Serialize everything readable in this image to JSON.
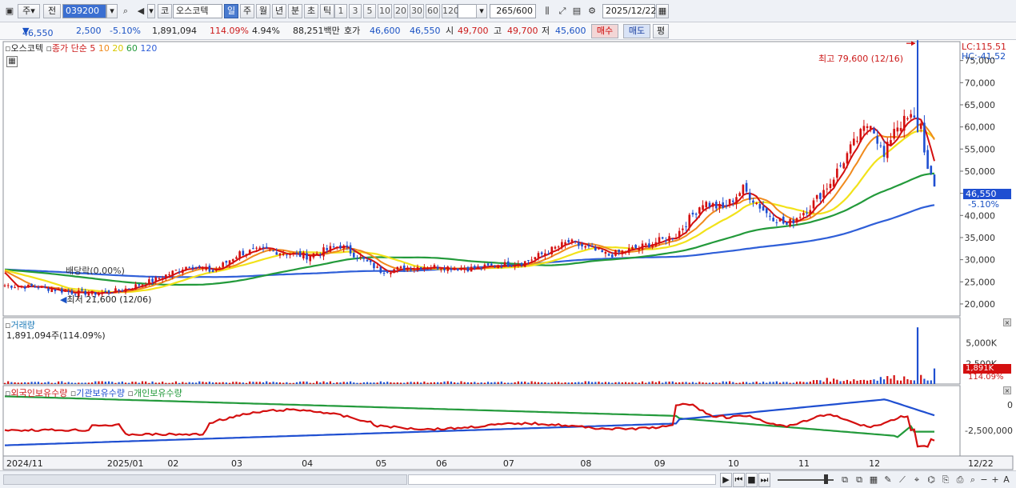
{
  "toolbar": {
    "period": "주",
    "prev": "전",
    "code": "039200",
    "market": "코",
    "name": "오스코텍",
    "intervals": [
      "일",
      "주",
      "월",
      "년",
      "분",
      "초",
      "틱"
    ],
    "selected_interval": "일",
    "minutes": [
      "1",
      "3",
      "5",
      "10",
      "20",
      "30",
      "60",
      "120"
    ],
    "count": "265",
    "count_total": "/600",
    "date": "2025/12/22"
  },
  "quote": {
    "price": "46,550",
    "change": "2,500",
    "change_pct": "-5.10%",
    "volume": "1,891,094",
    "vol_ratio": "114.09%",
    "turnover": "4.94%",
    "amount": "88,251백만",
    "ask_label": "호가",
    "ask": "46,600",
    "bid": "46,550",
    "open_label": "시",
    "open": "49,700",
    "high_label": "고",
    "high": "49,700",
    "low_label": "저",
    "low": "45,600",
    "buy": "매수",
    "sell": "매도",
    "eval": "평"
  },
  "legend": {
    "stock": "오스코텍",
    "ma_label": "종가 단순",
    "ma_periods": [
      "5",
      "10",
      "20",
      "60",
      "120"
    ],
    "lc": "LC:115.51",
    "hc": "HC:-41.52",
    "max_note": "최고 79,600 (12/16)",
    "min_note": "최저 21,600 (12/06)",
    "dividend": "배당락(0.00%)",
    "price_tag": "46,550",
    "price_pct": "-5.10%",
    "vol_title": "거래량",
    "vol_value": "1,891,094주(114.09%)",
    "vol_tag": "1,891K",
    "vol_pct": "114.09%",
    "holders": [
      "외국인보유수량",
      "기관보유수량",
      "개인보유수량"
    ]
  },
  "axes": {
    "price_ticks": [
      "75,000",
      "70,000",
      "65,000",
      "60,000",
      "55,000",
      "50,000",
      "45,000",
      "40,000",
      "35,000",
      "30,000",
      "25,000",
      "20,000"
    ],
    "vol_ticks": [
      "5,000K",
      "2,500K"
    ],
    "hold_ticks": [
      "0",
      "-2,500,000"
    ],
    "months": [
      "2024/11",
      "2025/01",
      "02",
      "03",
      "04",
      "05",
      "06",
      "07",
      "08",
      "09",
      "10",
      "11",
      "12"
    ],
    "right_date": "12/22"
  },
  "colors": {
    "up": "#d40f0f",
    "down": "#1f4fd1",
    "ma5": "#d40f0f",
    "ma10": "#f08a1c",
    "ma20": "#f2e21a",
    "ma60": "#239a3b",
    "ma120": "#2f5fd8"
  },
  "chart_data": {
    "type": "candlestick",
    "price_ylim": [
      18000,
      80000
    ],
    "anchors": [
      {
        "d": 0,
        "p": 24200
      },
      {
        "d": 10,
        "p": 23800
      },
      {
        "d": 20,
        "p": 22600
      },
      {
        "d": 28,
        "p": 22400
      },
      {
        "d": 35,
        "p": 23200
      },
      {
        "d": 45,
        "p": 25500
      },
      {
        "d": 55,
        "p": 28800
      },
      {
        "d": 62,
        "p": 27300
      },
      {
        "d": 70,
        "p": 31500
      },
      {
        "d": 78,
        "p": 32200
      },
      {
        "d": 90,
        "p": 30800
      },
      {
        "d": 100,
        "p": 33200
      },
      {
        "d": 112,
        "p": 27500
      },
      {
        "d": 125,
        "p": 28500
      },
      {
        "d": 140,
        "p": 28000
      },
      {
        "d": 155,
        "p": 29500
      },
      {
        "d": 168,
        "p": 34000
      },
      {
        "d": 180,
        "p": 31000
      },
      {
        "d": 190,
        "p": 33000
      },
      {
        "d": 200,
        "p": 35500
      },
      {
        "d": 208,
        "p": 43000
      },
      {
        "d": 214,
        "p": 41500
      },
      {
        "d": 220,
        "p": 46000
      },
      {
        "d": 227,
        "p": 40500
      },
      {
        "d": 233,
        "p": 37800
      },
      {
        "d": 240,
        "p": 42000
      },
      {
        "d": 246,
        "p": 47500
      },
      {
        "d": 252,
        "p": 55000
      },
      {
        "d": 258,
        "p": 61500
      },
      {
        "d": 262,
        "p": 53000
      },
      {
        "d": 265,
        "p": 60000
      },
      {
        "d": 270,
        "p": 62000
      },
      {
        "d": 273,
        "p": 60500
      },
      {
        "d": 275,
        "p": 50000
      },
      {
        "d": 277,
        "p": 46550
      }
    ],
    "spike_day": 272,
    "spike_high": 79600,
    "volume_spike": 6900,
    "volume_last": 1891,
    "volume_ylim": [
      0,
      7500
    ]
  }
}
